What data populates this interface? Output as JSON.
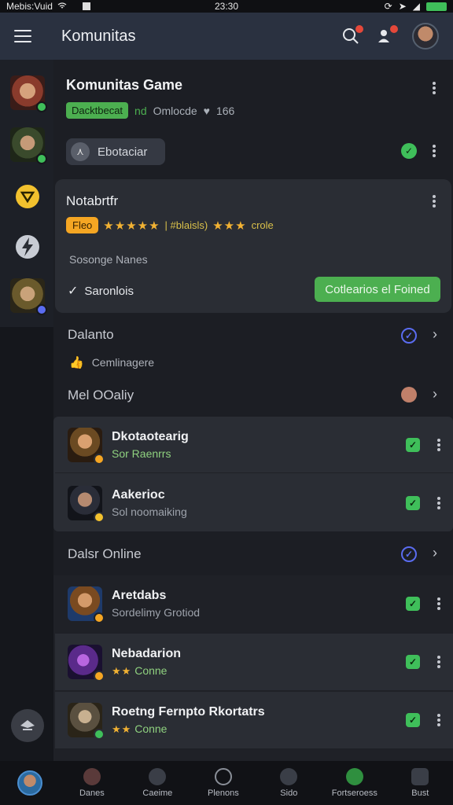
{
  "status_bar": {
    "carrier": "Mebis:Vuid",
    "time": "23:30"
  },
  "app_bar": {
    "title": "Komunitas"
  },
  "colors": {
    "accent_green": "#4caf50",
    "accent_orange": "#f5a623",
    "appbar_bg": "#2a3140",
    "check_blue": "#5a6cf0"
  },
  "sidebar": {
    "items": [
      {
        "icon": "guild-avatar-1",
        "status": "green"
      },
      {
        "icon": "guild-avatar-2",
        "status": "green"
      },
      {
        "icon": "yellow-down-icon"
      },
      {
        "icon": "lightning-shield-icon"
      },
      {
        "icon": "guild-avatar-3",
        "status": "blue"
      }
    ]
  },
  "game_card": {
    "title": "Komunitas Game",
    "badge": "Dacktbecat",
    "meta_prefix": "nd",
    "meta_label": "Omlocde",
    "meta_count": "166",
    "chip_label": "Ebotaciar"
  },
  "note_card": {
    "title": "Notabrtfr",
    "tag": "Fleo",
    "stars_left": "★★★★★",
    "rating_text": "| #blaisls)",
    "stars_right": "★★★",
    "rating_suffix": "crole",
    "subtitle": "Sosonge Nanes",
    "check_label": "Saronlois",
    "button_label": "Cotlearios el Foined"
  },
  "sections": {
    "dalants": {
      "label": "Dalanto",
      "sub_label": "Cemlinagere"
    },
    "mel_odaliy": {
      "label": "Mel OOaliy"
    },
    "dalsr_online": {
      "label": "Dalsr Online"
    }
  },
  "list1": [
    {
      "name": "Dkotaotearig",
      "sub": "Sor Raenrrs",
      "sub_style": "green"
    },
    {
      "name": "Aakerioc",
      "sub": "Sol noomaiking",
      "sub_style": "grey"
    }
  ],
  "list2": [
    {
      "name": "Aretdabs",
      "sub": "Sordelimy Grotiod",
      "sub_style": "grey"
    },
    {
      "name": "Nebadarion",
      "stars": "★★",
      "sub": "Conne",
      "sub_style": "green"
    },
    {
      "name": "Roetng Fernpto Rkortatrs",
      "stars": "★★",
      "sub": "Conne",
      "sub_style": "green"
    }
  ],
  "bottom_nav": [
    {
      "label": "Danes"
    },
    {
      "label": "Caeime"
    },
    {
      "label": "Plenons"
    },
    {
      "label": "Sido"
    },
    {
      "label": "Fortseroess"
    },
    {
      "label": "Bust"
    }
  ]
}
